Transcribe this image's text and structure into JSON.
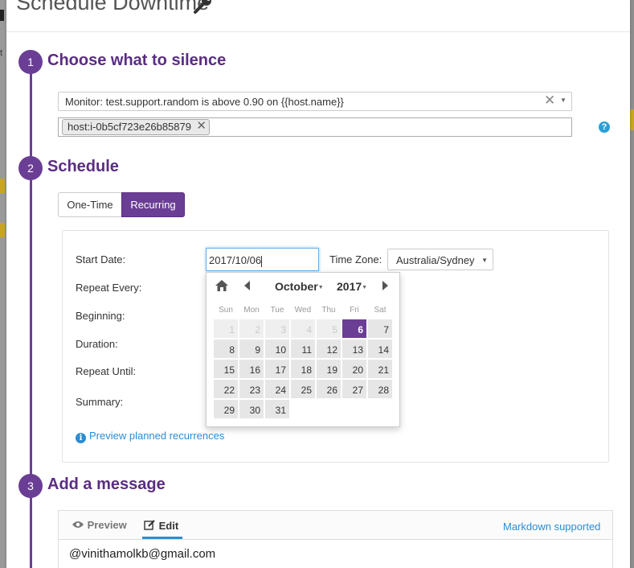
{
  "modal": {
    "title": "Schedule Downtime"
  },
  "steps": [
    {
      "number": "1",
      "title": "Choose what to silence"
    },
    {
      "number": "2",
      "title": "Schedule"
    },
    {
      "number": "3",
      "title": "Add a message"
    }
  ],
  "silence": {
    "monitor_value": "Monitor: test.support.random is above 0.90 on {{host.name}}",
    "clear_glyph": "✕",
    "scope_tag": "host:i-0b5cf723e26b85879",
    "help_glyph": "?"
  },
  "schedule": {
    "mode_one_time": "One-Time",
    "mode_recurring": "Recurring",
    "selected_mode": "Recurring",
    "labels": {
      "start_date": "Start Date:",
      "repeat_every": "Repeat Every:",
      "beginning": "Beginning:",
      "duration": "Duration:",
      "repeat_until": "Repeat Until:",
      "summary": "Summary:"
    },
    "start_date_value": "2017/10/06",
    "time_zone_label": "Time Zone:",
    "time_zone_value": "Australia/Sydney",
    "preview_link": "Preview planned recurrences",
    "info_glyph": "i"
  },
  "calendar": {
    "month": "October",
    "year": "2017",
    "dow": [
      "Sun",
      "Mon",
      "Tue",
      "Wed",
      "Thu",
      "Fri",
      "Sat"
    ],
    "weeks": [
      [
        "1",
        "2",
        "3",
        "4",
        "5",
        "6",
        "7"
      ],
      [
        "8",
        "9",
        "10",
        "11",
        "12",
        "13",
        "14"
      ],
      [
        "15",
        "16",
        "17",
        "18",
        "19",
        "20",
        "21"
      ],
      [
        "22",
        "23",
        "24",
        "25",
        "26",
        "27",
        "28"
      ],
      [
        "29",
        "30",
        "31"
      ]
    ],
    "disabled_days": [
      "1",
      "2",
      "3",
      "4",
      "5"
    ],
    "selected_day": "6"
  },
  "message": {
    "tab_preview": "Preview",
    "tab_edit": "Edit",
    "active_tab": "Edit",
    "markdown_link": "Markdown supported",
    "text": "@vinithamolkb@gmail.com"
  },
  "colors": {
    "accent": "#6b3e95",
    "step_title": "#5a2d82",
    "link": "#2a8dd4",
    "focus": "#66afe9"
  },
  "icons": {
    "title_icon": "wrench-icon",
    "home": "home-icon",
    "prev": "chevron-left-icon",
    "next": "chevron-right-icon",
    "preview_tab": "eye-icon",
    "edit_tab": "edit-icon",
    "help": "question-icon",
    "info": "info-icon"
  }
}
